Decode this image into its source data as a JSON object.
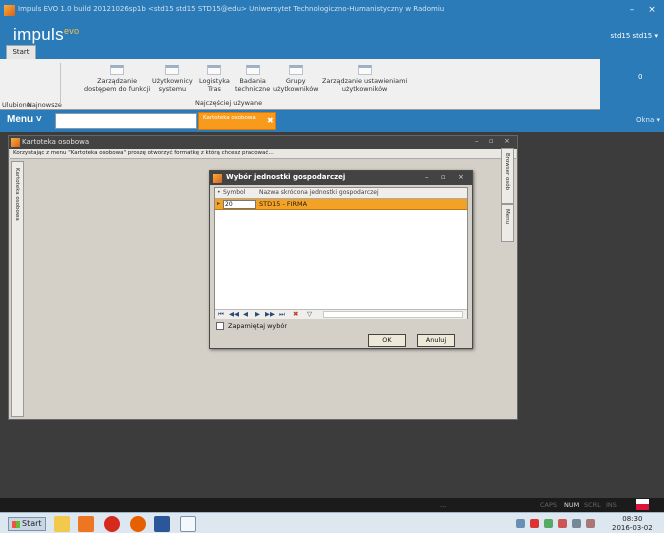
{
  "window": {
    "title": "Impuls EVO 1.0 build 20121026sp1b <std15 std15 STD15@edu> Uniwersytet Technologiczno-Humanistyczny w Radomiu",
    "minimize": "–",
    "close": "×"
  },
  "header": {
    "logo_text": "impuls",
    "logo_sup": "evo",
    "user": "std15 std15 ▾",
    "start_tab": "Start"
  },
  "ribbon": {
    "left_items": [
      "Ulubione",
      "Najnowsze"
    ],
    "buttons": [
      {
        "line1": "Zarządzanie",
        "line2": "dostępem do funkcji"
      },
      {
        "line1": "Użytkownicy",
        "line2": "systemu"
      },
      {
        "line1": "Logistyka",
        "line2": "Tras"
      },
      {
        "line1": "Badania",
        "line2": "techniczne"
      },
      {
        "line1": "Grupy",
        "line2": "użytkowników"
      },
      {
        "line1": "Zarządzanie ustawieniami",
        "line2": "użytkowników"
      }
    ],
    "group_label": "Najczęściej używane",
    "right_value": "0"
  },
  "menubar": {
    "menu_label": "Menu ˅",
    "search_value": "",
    "doc_tab": "Kartoteka osobowa",
    "doc_tab_close": "✖",
    "windows_label": "Okna ▾"
  },
  "kartoteka": {
    "title": "Kartoteka osobowa",
    "controls": [
      "–",
      "▫",
      "×"
    ],
    "hint": "Korzystając z menu \"Kartoteka osobowa\" proszę otworzyć formatkę z którą chcesz pracować...",
    "left_rail": "Kartoteka osobowa",
    "right_rail_top": "Browser osób",
    "right_rail_menu": "Menu"
  },
  "dialog": {
    "title": "Wybór jednostki gospodarczej",
    "controls": [
      "–",
      "▫",
      "×"
    ],
    "columns": [
      "Symbol",
      "Nazwa skrócona jednostki gospodarczej"
    ],
    "rows": [
      {
        "indicator": "▸",
        "symbol": "20",
        "name": "STD15 - FIRMA"
      }
    ],
    "nav": [
      "⏮",
      "◀◀",
      "◀",
      "▶",
      "▶▶",
      "⏭",
      "✖",
      "▽"
    ],
    "remember_label": "Zapamiętaj wybór",
    "ok_label": "OK",
    "cancel_label": "Anuluj"
  },
  "status": {
    "dots": "...",
    "keys": [
      {
        "label": "CAPS",
        "on": false
      },
      {
        "label": "NUM",
        "on": true
      },
      {
        "label": "SCRL",
        "on": false
      },
      {
        "label": "INS",
        "on": false
      }
    ]
  },
  "taskbar": {
    "start_label": "Start",
    "time": "08:30",
    "date": "2016-03-02"
  },
  "colors": {
    "accent": "#2b7bb9",
    "workspace": "#3c3c3c",
    "highlight": "#f3a226"
  }
}
